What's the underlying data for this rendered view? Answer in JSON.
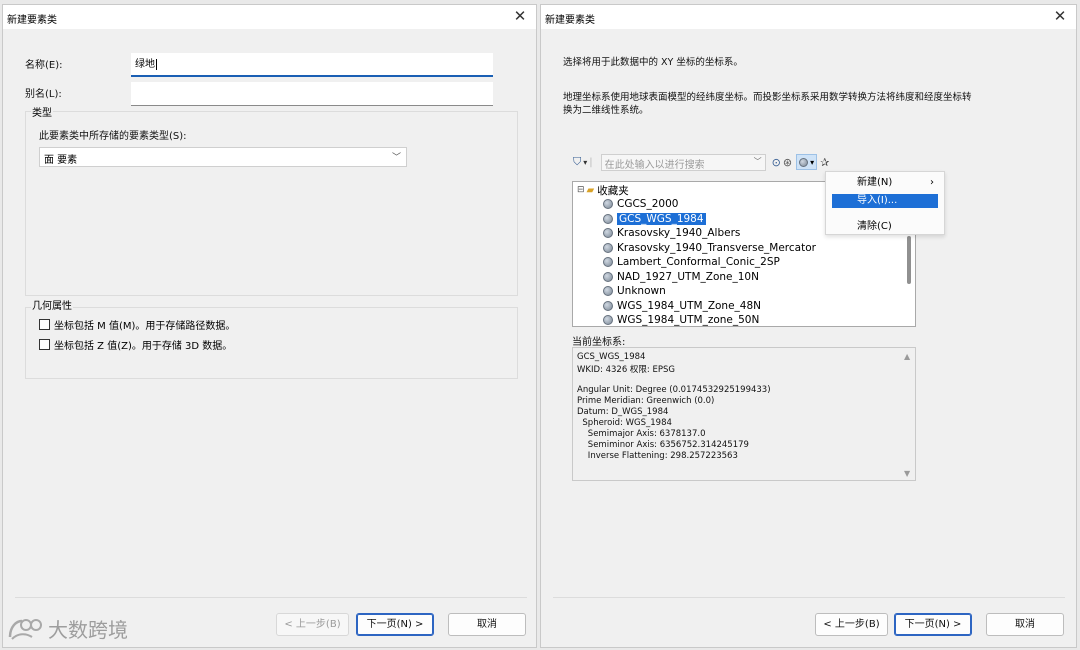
{
  "left": {
    "title": "新建要素类",
    "close": "✕",
    "name_label": "名称(E):",
    "name_value": "绿地",
    "alias_label": "别名(L):",
    "alias_value": "",
    "type_group": "类型",
    "type_prompt": "此要素类中所存储的要素类型(S):",
    "type_value": "面 要素",
    "geometry_group": "几何属性",
    "check_m": "坐标包括 M 值(M)。用于存储路径数据。",
    "check_z": "坐标包括 Z 值(Z)。用于存储 3D 数据。",
    "btn_back": "< 上一步(B)",
    "btn_next": "下一页(N) >",
    "btn_cancel": "取消"
  },
  "right": {
    "title": "新建要素类",
    "close": "✕",
    "intro": "选择将用于此数据中的 XY 坐标的坐标系。",
    "desc_line1": "地理坐标系使用地球表面模型的经纬度坐标。而投影坐标系采用数学转换方法将纬度和经度坐标转",
    "desc_line2": "换为二维线性系统。",
    "search_placeholder": "在此处输入以进行搜索",
    "tree_root": "收藏夹",
    "tree_items": [
      "CGCS_2000",
      "GCS_WGS_1984",
      "Krasovsky_1940_Albers",
      "Krasovsky_1940_Transverse_Mercator",
      "Lambert_Conformal_Conic_2SP",
      "NAD_1927_UTM_Zone_10N",
      "Unknown",
      "WGS_1984_UTM_Zone_48N",
      "WGS_1984_UTM_zone_50N"
    ],
    "menu_new": "新建(N)",
    "menu_new_arrow": "›",
    "menu_import": "导入(I)...",
    "menu_clear": "清除(C)",
    "current_label": "当前坐标系:",
    "info_lines": [
      "GCS_WGS_1984",
      "WKID: 4326 权限: EPSG",
      "",
      "Angular Unit: Degree (0.0174532925199433)",
      "Prime Meridian: Greenwich (0.0)",
      "Datum: D_WGS_1984",
      "  Spheroid: WGS_1984",
      "    Semimajor Axis: 6378137.0",
      "    Semiminor Axis: 6356752.314245179",
      "    Inverse Flattening: 298.257223563"
    ],
    "btn_back": "< 上一步(B)",
    "btn_next": "下一页(N) >",
    "btn_cancel": "取消"
  },
  "watermark": "大数跨境"
}
